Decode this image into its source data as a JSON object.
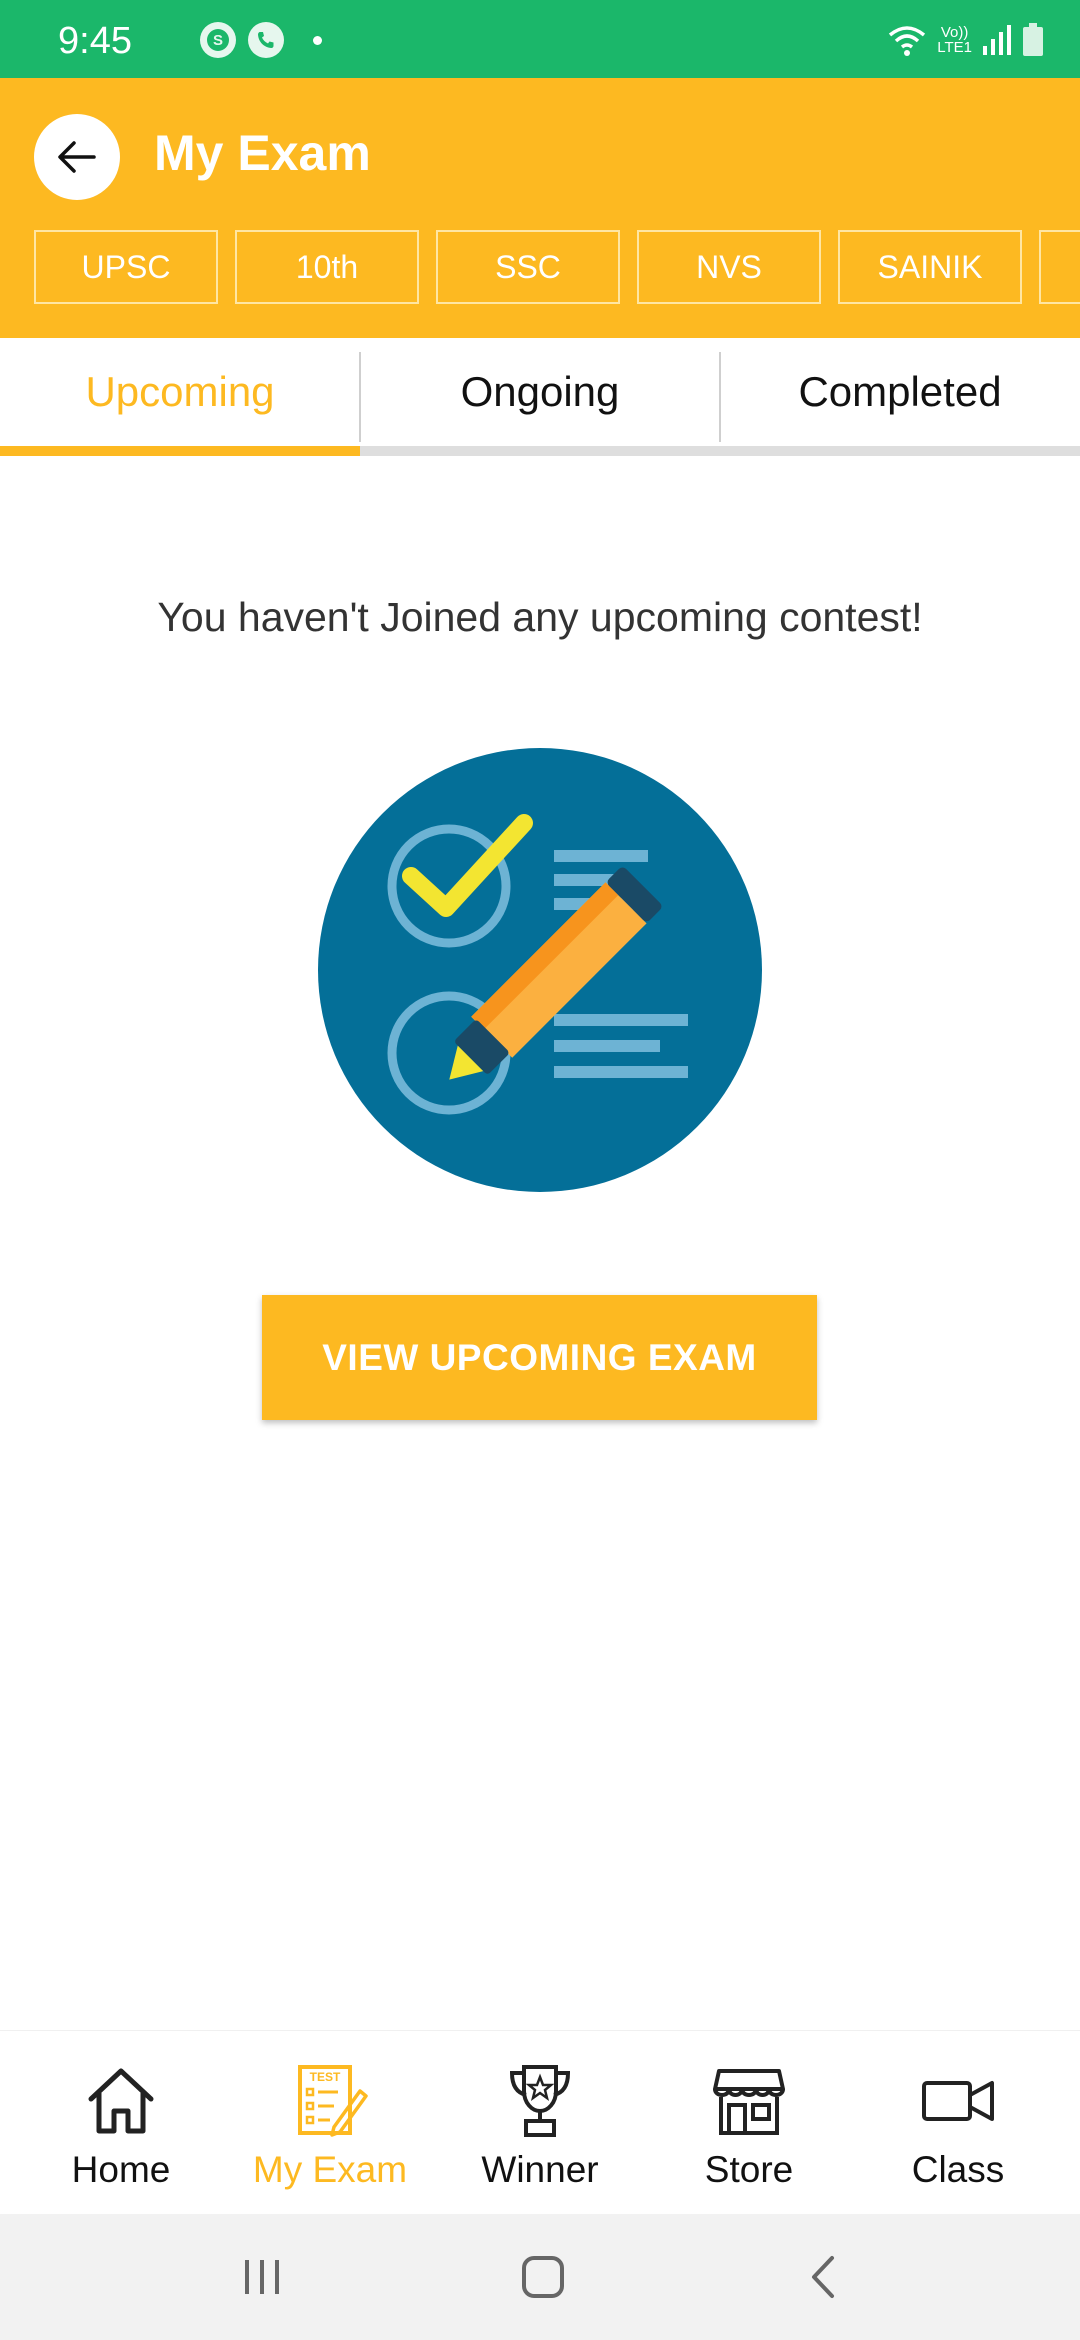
{
  "status_bar": {
    "time": "9:45",
    "app_icons": [
      "skype-icon",
      "phone-icon"
    ],
    "volte_label_top": "Vo))",
    "volte_label_bottom": "LTE1",
    "status_icons": [
      "wifi-icon",
      "volte-icon",
      "signal-icon",
      "battery-icon"
    ],
    "color": "#1bb76a"
  },
  "app_bar": {
    "title": "My Exam",
    "back_icon": "arrow-left-icon",
    "color": "#fdb921",
    "chips": [
      "UPSC",
      "10th",
      "SSC",
      "NVS",
      "SAINIK"
    ]
  },
  "tabs": {
    "items": [
      "Upcoming",
      "Ongoing",
      "Completed"
    ],
    "active": "Upcoming"
  },
  "empty_state": {
    "message": "You haven't Joined any upcoming contest!",
    "illustration": "exam-checklist-pencil-illustration",
    "button_label": "VIEW UPCOMING EXAM"
  },
  "bottom_nav": {
    "items": [
      {
        "label": "Home",
        "icon": "home-icon"
      },
      {
        "label": "My Exam",
        "icon": "test-sheet-icon"
      },
      {
        "label": "Winner",
        "icon": "trophy-icon"
      },
      {
        "label": "Store",
        "icon": "store-icon"
      },
      {
        "label": "Class",
        "icon": "video-camera-icon"
      }
    ],
    "active": "My Exam",
    "active_color": "#fdb921"
  },
  "system_nav": {
    "buttons": [
      "recents-icon",
      "home-button-icon",
      "back-chevron-icon"
    ]
  }
}
